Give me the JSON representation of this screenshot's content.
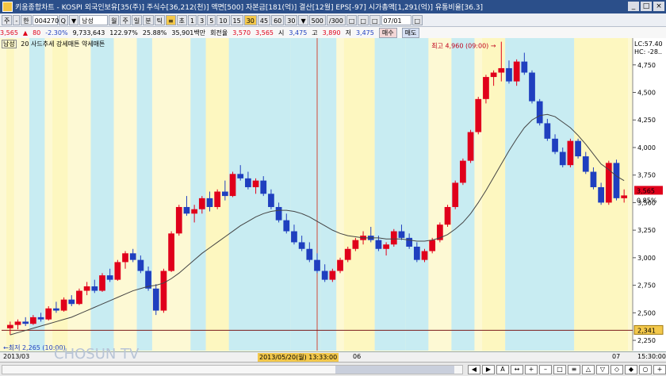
{
  "window": {
    "title": "키움종합차트 - KOSPI 외국인보유[35(주)] 주식수[36,212(천)] 액면[500] 자본금[181(억)] 결산[12월] EPS[-97] 시가총액[1,291(억)] 유통비율[36.3]",
    "min_label": "_",
    "max_label": "□",
    "close_label": "×"
  },
  "toolbar": {
    "items": [
      "주",
      "-",
      "한",
      "004270",
      "Q",
      "▼",
      "남성",
      "월",
      "주",
      "일",
      "분",
      "틱",
      "≡",
      "초",
      "1",
      "3",
      "5",
      "10",
      "15",
      "30",
      "45",
      "60",
      "30",
      "▼",
      "500",
      "/300",
      "□",
      "□",
      "□",
      "07/01",
      "□"
    ]
  },
  "quote": {
    "price": "3,565",
    "arrow": "▲",
    "change": "80",
    "change_rate": "-2.30%",
    "volume": "9,733,643",
    "volume_ratio": "122.97%",
    "turnover": "25.88%",
    "amount": "35,901백만",
    "turnover_label": "회전율",
    "bid1": "3,570",
    "bid2": "3,565",
    "open_label": "시",
    "open": "3,475",
    "high_label": "고",
    "high": "3,890",
    "low_label": "저",
    "low": "3,475",
    "buy_label": "매수",
    "sell_label": "매도"
  },
  "legend": {
    "stock": "남성",
    "ma": "20",
    "indicators": "사드추세 강세매튼 약세매튼"
  },
  "chart_data": {
    "type": "candlestick",
    "y_ticks": [
      "4,750",
      "4,500",
      "4,250",
      "4,000",
      "3,750",
      "3,500",
      "3,250",
      "3,000",
      "2,750",
      "2,500",
      "2,250"
    ],
    "ylim": [
      2200,
      4950
    ],
    "high_annotation": "최고 4,960 (09:00) →",
    "low_annotation": "←최저 2,265 (10:00)",
    "top_right_labels": [
      "LC:57.40",
      "HC: -28.."
    ],
    "current_price_label": "3,565",
    "current_rate_label": "0.85%",
    "reference_line_label": "2,341",
    "reference_line_value": 2341,
    "x_labels": [
      "2013/03",
      "06",
      "07"
    ],
    "cursor_label": "2013/05/20(월) 13:33:00",
    "last_label": "15:30:00",
    "candles": [
      [
        2360,
        2420,
        2300,
        2390
      ],
      [
        2390,
        2440,
        2350,
        2420
      ],
      [
        2420,
        2460,
        2380,
        2400
      ],
      [
        2400,
        2480,
        2390,
        2460
      ],
      [
        2460,
        2500,
        2420,
        2440
      ],
      [
        2440,
        2560,
        2430,
        2540
      ],
      [
        2540,
        2600,
        2500,
        2520
      ],
      [
        2520,
        2640,
        2510,
        2620
      ],
      [
        2620,
        2660,
        2560,
        2580
      ],
      [
        2580,
        2720,
        2570,
        2700
      ],
      [
        2700,
        2780,
        2660,
        2740
      ],
      [
        2740,
        2800,
        2680,
        2700
      ],
      [
        2700,
        2860,
        2690,
        2840
      ],
      [
        2840,
        2900,
        2780,
        2800
      ],
      [
        2800,
        2980,
        2790,
        2960
      ],
      [
        2960,
        3060,
        2900,
        3040
      ],
      [
        3040,
        3080,
        2960,
        2980
      ],
      [
        2980,
        3020,
        2860,
        2880
      ],
      [
        2880,
        2920,
        2700,
        2720
      ],
      [
        2720,
        2760,
        2480,
        2520
      ],
      [
        2520,
        2900,
        2500,
        2880
      ],
      [
        2880,
        3240,
        2870,
        3220
      ],
      [
        3220,
        3480,
        3200,
        3460
      ],
      [
        3460,
        3560,
        3380,
        3400
      ],
      [
        3400,
        3480,
        3320,
        3440
      ],
      [
        3440,
        3560,
        3400,
        3540
      ],
      [
        3540,
        3600,
        3420,
        3460
      ],
      [
        3460,
        3620,
        3440,
        3600
      ],
      [
        3600,
        3700,
        3520,
        3560
      ],
      [
        3560,
        3780,
        3550,
        3760
      ],
      [
        3760,
        3840,
        3700,
        3720
      ],
      [
        3720,
        3780,
        3620,
        3640
      ],
      [
        3640,
        3720,
        3580,
        3700
      ],
      [
        3700,
        3740,
        3560,
        3580
      ],
      [
        3580,
        3620,
        3440,
        3460
      ],
      [
        3460,
        3500,
        3320,
        3340
      ],
      [
        3340,
        3400,
        3220,
        3240
      ],
      [
        3240,
        3300,
        3120,
        3140
      ],
      [
        3140,
        3200,
        3060,
        3080
      ],
      [
        3080,
        3140,
        2960,
        2980
      ],
      [
        2980,
        3040,
        2860,
        2880
      ],
      [
        2880,
        2940,
        2780,
        2800
      ],
      [
        2800,
        2900,
        2780,
        2880
      ],
      [
        2880,
        3000,
        2860,
        2980
      ],
      [
        2980,
        3100,
        2960,
        3080
      ],
      [
        3080,
        3180,
        3060,
        3160
      ],
      [
        3160,
        3240,
        3120,
        3200
      ],
      [
        3200,
        3280,
        3140,
        3160
      ],
      [
        3160,
        3200,
        3060,
        3080
      ],
      [
        3080,
        3140,
        3020,
        3120
      ],
      [
        3120,
        3260,
        3100,
        3240
      ],
      [
        3240,
        3300,
        3160,
        3180
      ],
      [
        3180,
        3220,
        3080,
        3100
      ],
      [
        3100,
        3140,
        2960,
        2980
      ],
      [
        2980,
        3080,
        2960,
        3060
      ],
      [
        3060,
        3180,
        3040,
        3160
      ],
      [
        3160,
        3320,
        3140,
        3300
      ],
      [
        3300,
        3480,
        3280,
        3460
      ],
      [
        3460,
        3700,
        3440,
        3680
      ],
      [
        3680,
        3900,
        3660,
        3880
      ],
      [
        3880,
        4160,
        3860,
        4140
      ],
      [
        4140,
        4460,
        4120,
        4440
      ],
      [
        4440,
        4660,
        4400,
        4640
      ],
      [
        4640,
        4700,
        4560,
        4680
      ],
      [
        4680,
        4960,
        4600,
        4720
      ],
      [
        4720,
        4790,
        4580,
        4600
      ],
      [
        4600,
        4800,
        4560,
        4780
      ],
      [
        4780,
        4860,
        4660,
        4680
      ],
      [
        4680,
        4700,
        4400,
        4420
      ],
      [
        4420,
        4440,
        4200,
        4220
      ],
      [
        4220,
        4260,
        4060,
        4080
      ],
      [
        4080,
        4120,
        3940,
        3960
      ],
      [
        3960,
        4000,
        3820,
        3840
      ],
      [
        3840,
        4080,
        3820,
        4060
      ],
      [
        4060,
        4080,
        3900,
        3920
      ],
      [
        3920,
        3960,
        3760,
        3780
      ],
      [
        3780,
        3820,
        3620,
        3640
      ],
      [
        3640,
        3680,
        3480,
        3500
      ],
      [
        3500,
        3880,
        3480,
        3860
      ],
      [
        3860,
        3890,
        3520,
        3540
      ],
      [
        3540,
        3620,
        3500,
        3565
      ]
    ],
    "ma": [
      2300,
      2320,
      2340,
      2360,
      2380,
      2400,
      2420,
      2440,
      2460,
      2490,
      2520,
      2550,
      2580,
      2610,
      2640,
      2670,
      2700,
      2720,
      2740,
      2750,
      2770,
      2810,
      2860,
      2920,
      2980,
      3040,
      3090,
      3140,
      3190,
      3240,
      3290,
      3330,
      3370,
      3400,
      3420,
      3430,
      3430,
      3420,
      3400,
      3370,
      3330,
      3290,
      3250,
      3220,
      3200,
      3190,
      3180,
      3180,
      3180,
      3170,
      3170,
      3170,
      3160,
      3150,
      3150,
      3160,
      3180,
      3210,
      3260,
      3320,
      3400,
      3500,
      3610,
      3730,
      3850,
      3970,
      4080,
      4180,
      4250,
      4290,
      4300,
      4280,
      4230,
      4180,
      4110,
      4030,
      3940,
      3850,
      3800,
      3740,
      3700
    ],
    "bands": [
      {
        "from": 0,
        "to": 1,
        "color": "#fdf7c0"
      },
      {
        "from": 3,
        "to": 5,
        "color": "#c8ecf2"
      },
      {
        "from": 6,
        "to": 8,
        "color": "#fdf7c0"
      },
      {
        "from": 11,
        "to": 14,
        "color": "#c8ecf2"
      },
      {
        "from": 17,
        "to": 19,
        "color": "#c8ecf2"
      },
      {
        "from": 24,
        "to": 26,
        "color": "#c8ecf2"
      },
      {
        "from": 26,
        "to": 29,
        "color": "#fdf7c0"
      },
      {
        "from": 29,
        "to": 37,
        "color": "#c8ecf2"
      },
      {
        "from": 37,
        "to": 41,
        "color": "#c8ecf2"
      },
      {
        "from": 41,
        "to": 43,
        "color": "#c8ecf2"
      },
      {
        "from": 44,
        "to": 48,
        "color": "#fdf7c0"
      },
      {
        "from": 48,
        "to": 52,
        "color": "#c8ecf2"
      },
      {
        "from": 52,
        "to": 55,
        "color": "#c8ecf2"
      },
      {
        "from": 58,
        "to": 61,
        "color": "#c8ecf2"
      },
      {
        "from": 62,
        "to": 65,
        "color": "#fdf7c0"
      },
      {
        "from": 65,
        "to": 74,
        "color": "#c8ecf2"
      },
      {
        "from": 74,
        "to": 81,
        "color": "#fdf7c0"
      }
    ]
  },
  "colors": {
    "up": "#e0001b",
    "down": "#1f3fbf",
    "ma": "#444444",
    "cursor": "#d14a3a"
  },
  "watermark": "CHOSUN TV",
  "scroll": {
    "controls": [
      "◀",
      "▶",
      "A",
      "↔",
      "+",
      "–",
      "□",
      "≡",
      "△",
      "▽",
      "◇",
      "◆",
      "○",
      "+",
      "–",
      "×"
    ]
  }
}
